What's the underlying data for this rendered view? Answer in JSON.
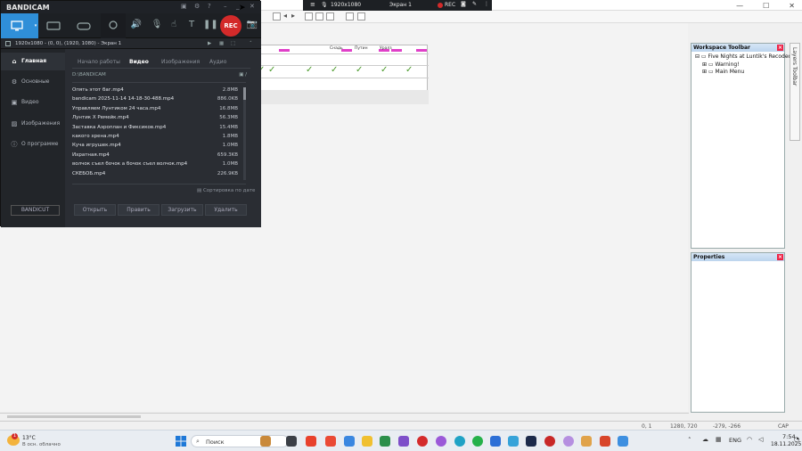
{
  "recording_bar": {
    "resolution": "1920x1080",
    "screen": "Экран 1",
    "rec_label": "REC"
  },
  "bandicam": {
    "logo": "BANDICAM",
    "rec_button": "REC",
    "target": "1920x1080 - (0, 0), (1920, 1080) - Экран 1",
    "sidebar": [
      {
        "label": "Главная",
        "icon": "home-icon",
        "active": true
      },
      {
        "label": "Основные",
        "icon": "gear-icon",
        "active": false
      },
      {
        "label": "Видео",
        "icon": "video-icon",
        "active": false
      },
      {
        "label": "Изображения",
        "icon": "image-icon",
        "active": false
      },
      {
        "label": "О программе",
        "icon": "info-icon",
        "active": false
      }
    ],
    "bandicut": "BANDICUT",
    "tabs": [
      "Начало работы",
      "Видео",
      "Изображения",
      "Аудио"
    ],
    "active_tab": "Видео",
    "path": "D:\\BANDICAM",
    "files": [
      {
        "name": "Опять этот баг.mp4",
        "size": "2.8MB"
      },
      {
        "name": "bandicam 2025-11-14 14-18-30-488.mp4",
        "size": "886.0KB"
      },
      {
        "name": "Управляем Лунтиком 24 часа.mp4",
        "size": "16.8MB"
      },
      {
        "name": "Лунтик Х Ремейк.mp4",
        "size": "56.3MB"
      },
      {
        "name": "Заставка Аэроплан и Фиксиков.mp4",
        "size": "15.4MB"
      },
      {
        "name": "какого хрена.mp4",
        "size": "1.8MB"
      },
      {
        "name": "Куча игрушек.mp4",
        "size": "1.0MB"
      },
      {
        "name": "Ихратная.mp4",
        "size": "659.3KB"
      },
      {
        "name": "волчок съел бочок а бочок съел волчок.mp4",
        "size": "1.0MB"
      },
      {
        "name": "СКЕБОБ.mp4",
        "size": "226.9KB"
      }
    ],
    "sort_label": "Сортировка по дате",
    "actions": [
      "Открыть",
      "Править",
      "Загрузить",
      "Удалить"
    ]
  },
  "workspace": {
    "toolbar_title": "Workspace Toolbar",
    "tree": [
      {
        "label": "Five Nights at Luntik's Recoded *",
        "level": 0
      },
      {
        "label": "Warning!",
        "level": 1
      },
      {
        "label": "Main Menu",
        "level": 1
      }
    ],
    "properties_title": "Properties",
    "layers_tab": "Layers Toolbar",
    "status_left": "0, 1",
    "status_mid1": "1280, 720",
    "status_mid2": "-279, -266",
    "status_right": "CAP NUM",
    "grid_headers": [
      "Снадь",
      "Путин",
      "Уралз"
    ]
  },
  "taskbar": {
    "weather_temp": "13°C",
    "weather_desc": "В осн. облачно",
    "search_placeholder": "Поиск",
    "language": "ENG",
    "time": "7:54",
    "date": "18.11.2025"
  }
}
